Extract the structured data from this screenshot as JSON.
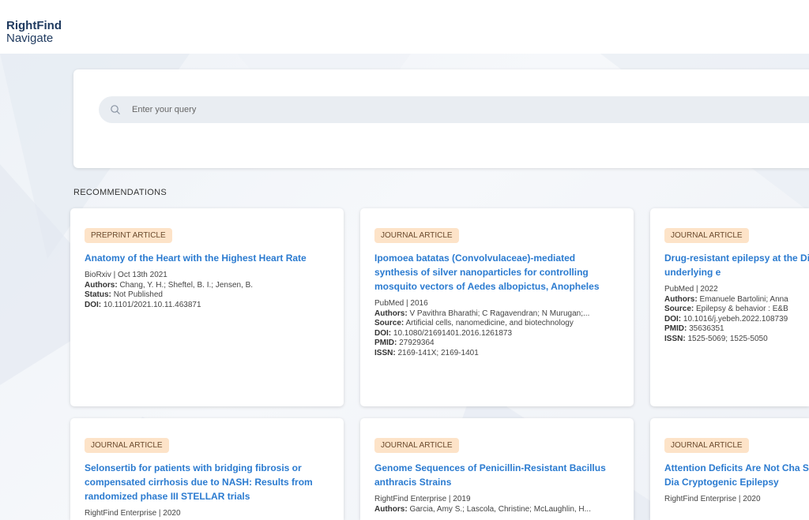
{
  "app": {
    "logo_line1": "RightFind",
    "logo_line2": "Navigate"
  },
  "search": {
    "placeholder": "Enter your query"
  },
  "recommendations": {
    "heading": "RECOMMENDATIONS",
    "cards": [
      {
        "badge": "PREPRINT ARTICLE",
        "title": "Anatomy of the Heart with the Highest Heart Rate",
        "source_line": "BioRxiv  |  Oct 13th 2021",
        "authors_label": "Authors:",
        "authors": "Chang, Y. H.; Sheftel, B. I.; Jensen, B.",
        "status_label": "Status:",
        "status": "Not Published",
        "doi_label": "DOI:",
        "doi": "10.1101/2021.10.11.463871"
      },
      {
        "badge": "JOURNAL ARTICLE",
        "title": "Ipomoea batatas (Convolvulaceae)-mediated synthesis of silver nanoparticles for controlling mosquito vectors of Aedes albopictus, Anopheles",
        "source_line": "PubMed  |  2016",
        "authors_label": "Authors:",
        "authors": "V Pavithra Bharathi; C Ragavendran; N Murugan;...",
        "source_label": "Source:",
        "source": "Artificial cells, nanomedicine, and biotechnology",
        "doi_label": "DOI:",
        "doi": "10.1080/21691401.2016.1261873",
        "pmid_label": "PMID:",
        "pmid": "27929364",
        "issn_label": "ISSN:",
        "issn": "2169-141X; 2169-1401"
      },
      {
        "badge": "JOURNAL ARTICLE",
        "title": "Drug-resistant epilepsy at the Disentangling the underlying e",
        "source_line": "PubMed  |  2022",
        "authors_label": "Authors:",
        "authors": "Emanuele Bartolini; Anna",
        "source_label": "Source:",
        "source": "Epilepsy & behavior : E&B",
        "doi_label": "DOI:",
        "doi": "10.1016/j.yebeh.2022.108739",
        "pmid_label": "PMID:",
        "pmid": "35636351",
        "issn_label": "ISSN:",
        "issn": "1525-5069; 1525-5050"
      },
      {
        "badge": "JOURNAL ARTICLE",
        "title": "Selonsertib for patients with bridging fibrosis or compensated cirrhosis due to NASH: Results from randomized phase III STELLAR trials",
        "source_line": "RightFind Enterprise  |  2020"
      },
      {
        "badge": "JOURNAL ARTICLE",
        "title": "Genome Sequences of Penicillin-Resistant Bacillus anthracis Strains",
        "source_line": "RightFind Enterprise  |  2019",
        "authors_label": "Authors:",
        "authors": "Garcia, Amy S.; Lascola, Christine; McLaughlin, H..."
      },
      {
        "badge": "JOURNAL ARTICLE",
        "title": "Attention Deficits Are Not Cha Schoolchildren with Newly Dia Cryptogenic Epilepsy",
        "source_line": "RightFind Enterprise  |  2020"
      }
    ]
  },
  "colors": {
    "accent": "#2b7bd0",
    "badge_bg": "#fde3c8",
    "brand": "#1f3a5f"
  }
}
